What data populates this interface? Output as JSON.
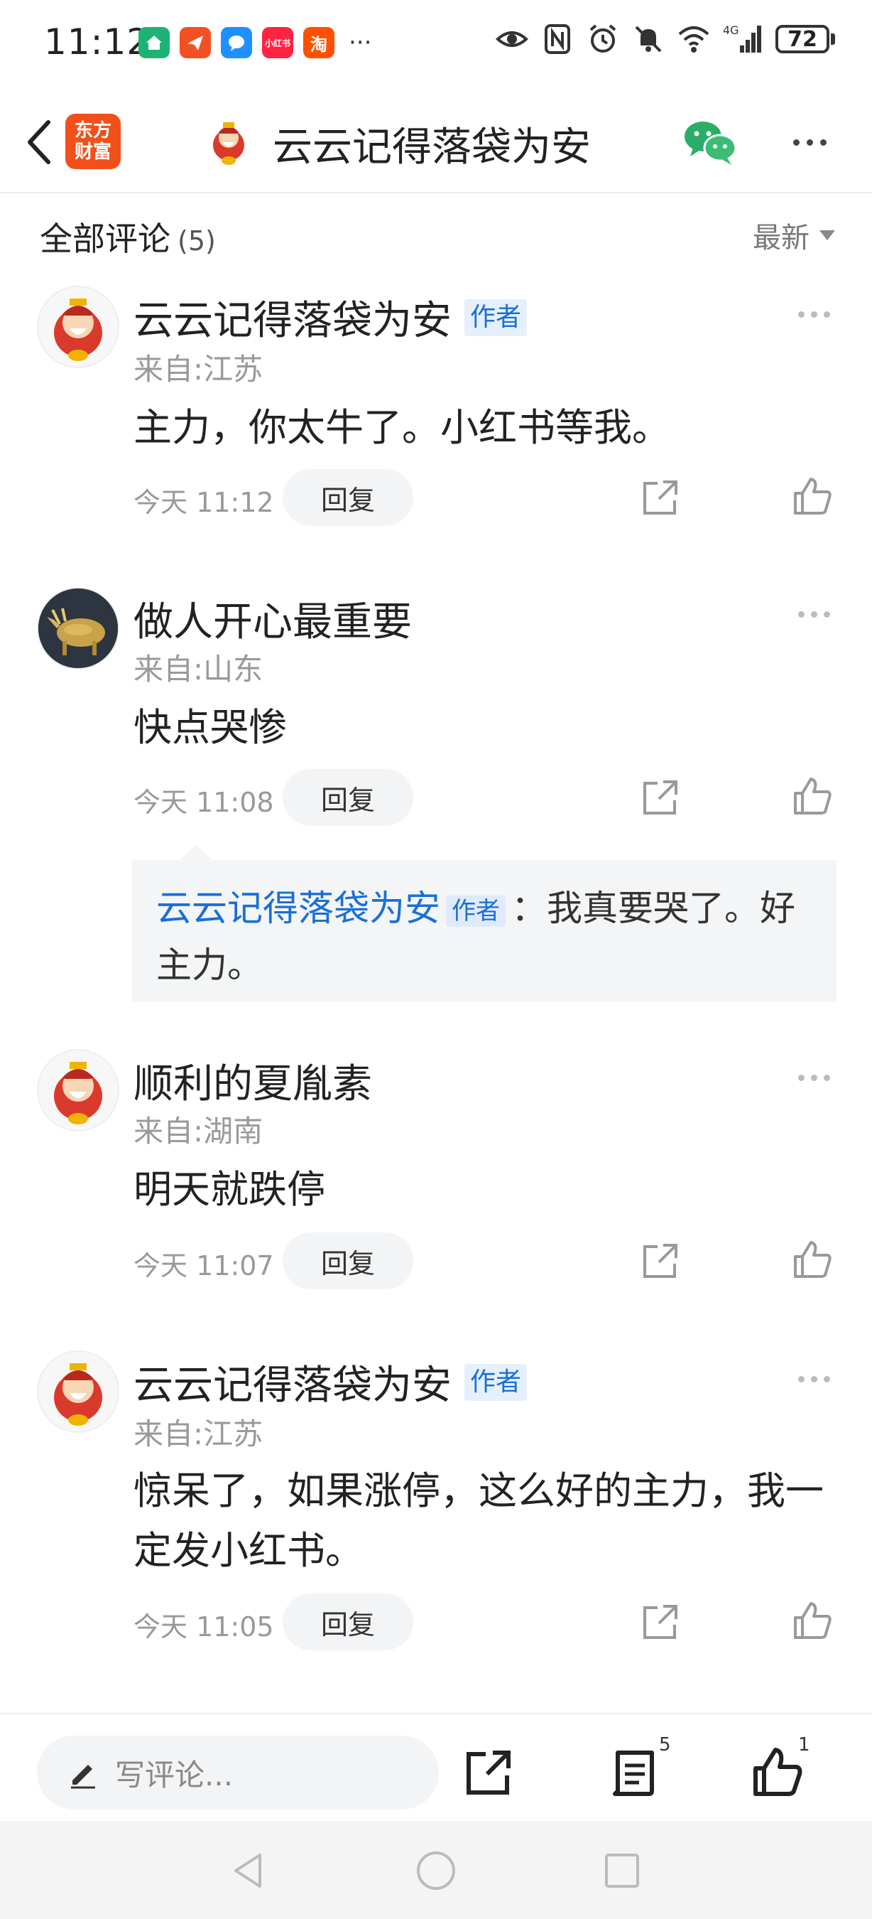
{
  "status_bar": {
    "time": "11:12",
    "apps": [
      {
        "icon": "home-app-icon",
        "color": "#1db374",
        "text": ""
      },
      {
        "icon": "paper-plane-app-icon",
        "color": "#f25022",
        "text": ""
      },
      {
        "icon": "chat-bubble-app-icon",
        "color": "#1e90ff",
        "text": ""
      },
      {
        "icon": "xiaohongshu-app-icon",
        "color": "#ff2442",
        "text": "小红书"
      },
      {
        "icon": "taobao-app-icon",
        "color": "#ff5000",
        "text": "淘"
      }
    ],
    "more": "···",
    "battery": "72",
    "network": "4G"
  },
  "nav": {
    "brand_line1": "东方",
    "brand_line2": "财富",
    "title": "云云记得落袋为安"
  },
  "comments_header": {
    "title": "全部评论",
    "count": "(5)",
    "sort": "最新"
  },
  "comments": [
    {
      "name": "云云记得落袋为安",
      "tag": "作者",
      "location": "来自:江苏",
      "text": "主力，你太牛了。小红书等我。",
      "time": "今天 11:12",
      "reply": "回复"
    },
    {
      "name": "做人开心最重要",
      "tag": "",
      "location": "来自:山东",
      "text": "快点哭惨",
      "time": "今天 11:08",
      "reply": "回复"
    },
    {
      "name": "顺利的夏胤素",
      "tag": "",
      "location": "来自:湖南",
      "text": "明天就跌停",
      "time": "今天 11:07",
      "reply": "回复"
    },
    {
      "name": "云云记得落袋为安",
      "tag": "作者",
      "location": "来自:江苏",
      "text": "惊呆了，如果涨停，这么好的主力，我一定发小红书。",
      "time": "今天 11:05",
      "reply": "回复"
    }
  ],
  "nested_reply": {
    "name": "云云记得落袋为安",
    "tag": "作者",
    "text": "：我真要哭了。好主力。"
  },
  "bottom_bar": {
    "placeholder": "写评论...",
    "comment_count": "5",
    "like_count": "1"
  },
  "colors": {
    "brand": "#f2501a",
    "link_blue": "#1a6fd6",
    "wechat_green": "#2aae67"
  }
}
